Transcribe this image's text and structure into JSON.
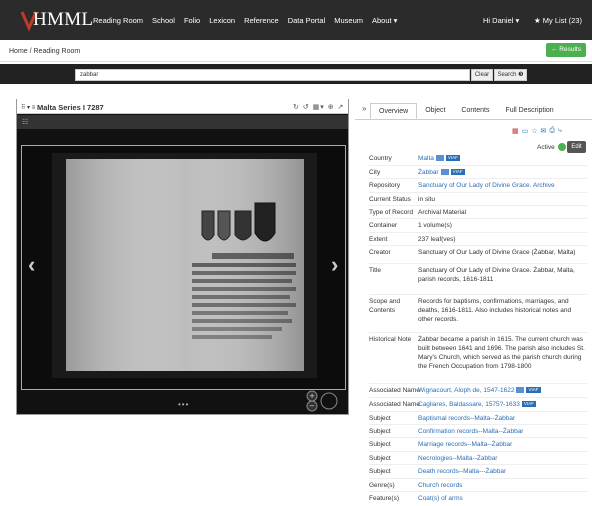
{
  "header": {
    "logo_text": "HMML",
    "nav": [
      "Reading Room",
      "School",
      "Folio",
      "Lexicon",
      "Reference",
      "Data Portal",
      "Museum",
      "About ▾"
    ],
    "user": "Hi Daniel ▾",
    "mylist": "★ My List (23)"
  },
  "breadcrumb": "Home / Reading Room",
  "results_label": "← Results",
  "search": {
    "value": "zabbar",
    "clear_label": "Clear",
    "search_label": "Search ❸"
  },
  "viewer": {
    "menu_icon": "⠿ ▾ ≡",
    "title": "Malta Series I 7287",
    "tools": "↻ ↺ ▦▾ ⊕ ↗",
    "filter_icon": "☷",
    "dots": "•••"
  },
  "details": {
    "collapse": "»",
    "tabs": [
      "Overview",
      "Object",
      "Contents",
      "Full Description"
    ],
    "active_label": "Active",
    "edit_label": "Edit",
    "viaf_label": "VIAF",
    "rows": [
      {
        "label": "Country",
        "value": "Malta",
        "link": true,
        "badges": true
      },
      {
        "label": "City",
        "value": "Żabbar",
        "link": true,
        "badges": true
      },
      {
        "label": "Repository",
        "value": "Sanctuary of Our Lady of Divine Grace. Archive",
        "link": true
      },
      {
        "label": "Current Status",
        "value": "in situ"
      },
      {
        "label": "Type of Record",
        "value": "Archival Material"
      },
      {
        "label": "Container",
        "value": "1 volume(s)"
      },
      {
        "label": "Extent",
        "value": "237 leaf(ves)"
      },
      {
        "label": "Creator",
        "value": "Sanctuary of Our Lady of Divine Grace (Żabbar, Malta)"
      },
      {
        "label": "Title",
        "value": "Sanctuary of Our Lady of Divine Grace. Żabbar, Malta, parish records, 1616-1811"
      },
      {
        "label": "Scope and Contents",
        "value": "Records for baptisms, confirmations, marriages, and deaths, 1616-1811. Also includes historical notes and other records."
      },
      {
        "label": "Historical Note",
        "value": "Żabbar became a parish in 1615. The current church was built between 1641 and 1696. The parish also includes St. Mary's Church, which served as the parish church during the French Occupation from 1798-1800"
      },
      {
        "label": "Associated Name",
        "value": "Wignacourt, Aloph de, 1547-1622",
        "link": true,
        "badges": true
      },
      {
        "label": "Associated Name",
        "value": "Cagliares, Baldassare, 1575?-1633",
        "link": true,
        "viafonly": true
      },
      {
        "label": "Subject",
        "value": "Baptismal records--Malta--Żabbar",
        "link": true
      },
      {
        "label": "Subject",
        "value": "Confirmation records--Malta--Żabbar",
        "link": true
      },
      {
        "label": "Subject",
        "value": "Marriage records--Malta--Żabbar",
        "link": true
      },
      {
        "label": "Subject",
        "value": "Necrologies--Malta--Żabbar",
        "link": true
      },
      {
        "label": "Subject",
        "value": "Death records--Malta---Żabbar",
        "link": true
      },
      {
        "label": "Genre(s)",
        "value": "Church records",
        "link": true
      },
      {
        "label": "Feature(s)",
        "value": "Coat(s) of arms",
        "link": true
      }
    ]
  }
}
